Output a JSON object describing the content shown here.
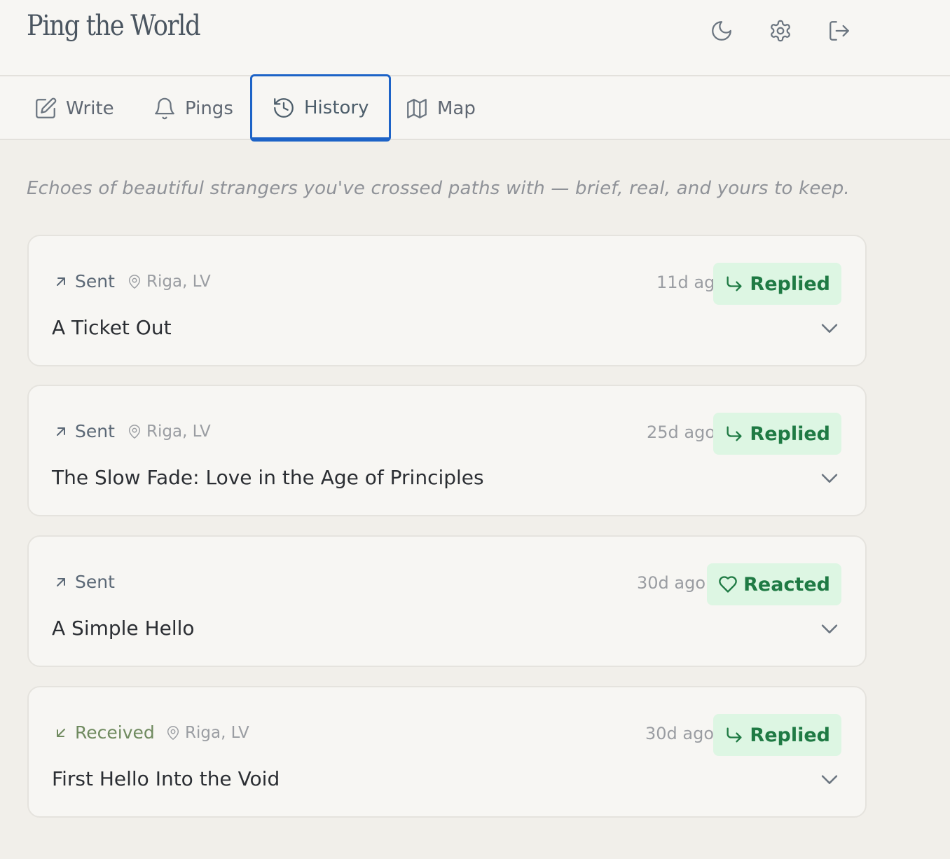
{
  "app": {
    "title": "Ping the World"
  },
  "header": {
    "actions": [
      {
        "icon": "moon-icon",
        "label": "Dark mode"
      },
      {
        "icon": "gear-icon",
        "label": "Settings"
      },
      {
        "icon": "logout-icon",
        "label": "Log out"
      }
    ]
  },
  "tabs": [
    {
      "label": "Write",
      "icon": "edit-icon",
      "active": false
    },
    {
      "label": "Pings",
      "icon": "bell-icon",
      "active": false
    },
    {
      "label": "History",
      "icon": "history-icon",
      "active": true
    },
    {
      "label": "Map",
      "icon": "map-icon",
      "active": false
    }
  ],
  "history": {
    "intro": "Echoes of beautiful strangers you've crossed paths with — brief, real, and yours to keep.",
    "items": [
      {
        "direction": "Sent",
        "location": "Riga, LV",
        "ago": "11d ago",
        "status": "Replied",
        "title": "A Ticket Out"
      },
      {
        "direction": "Sent",
        "location": "Riga, LV",
        "ago": "25d ago",
        "status": "Replied",
        "title": "The Slow Fade: Love in the Age of Principles"
      },
      {
        "direction": "Sent",
        "location": "",
        "ago": "30d ago",
        "status": "Reacted",
        "title": "A Simple Hello"
      },
      {
        "direction": "Received",
        "location": "Riga, LV",
        "ago": "30d ago",
        "status": "Replied",
        "title": "First Hello Into the Void"
      }
    ]
  },
  "colors": {
    "accent_focus": "#1d63c7",
    "status_badge_bg": "#ddf6e3",
    "status_badge_text": "#1f7a44",
    "received": "#6f8a5f"
  }
}
